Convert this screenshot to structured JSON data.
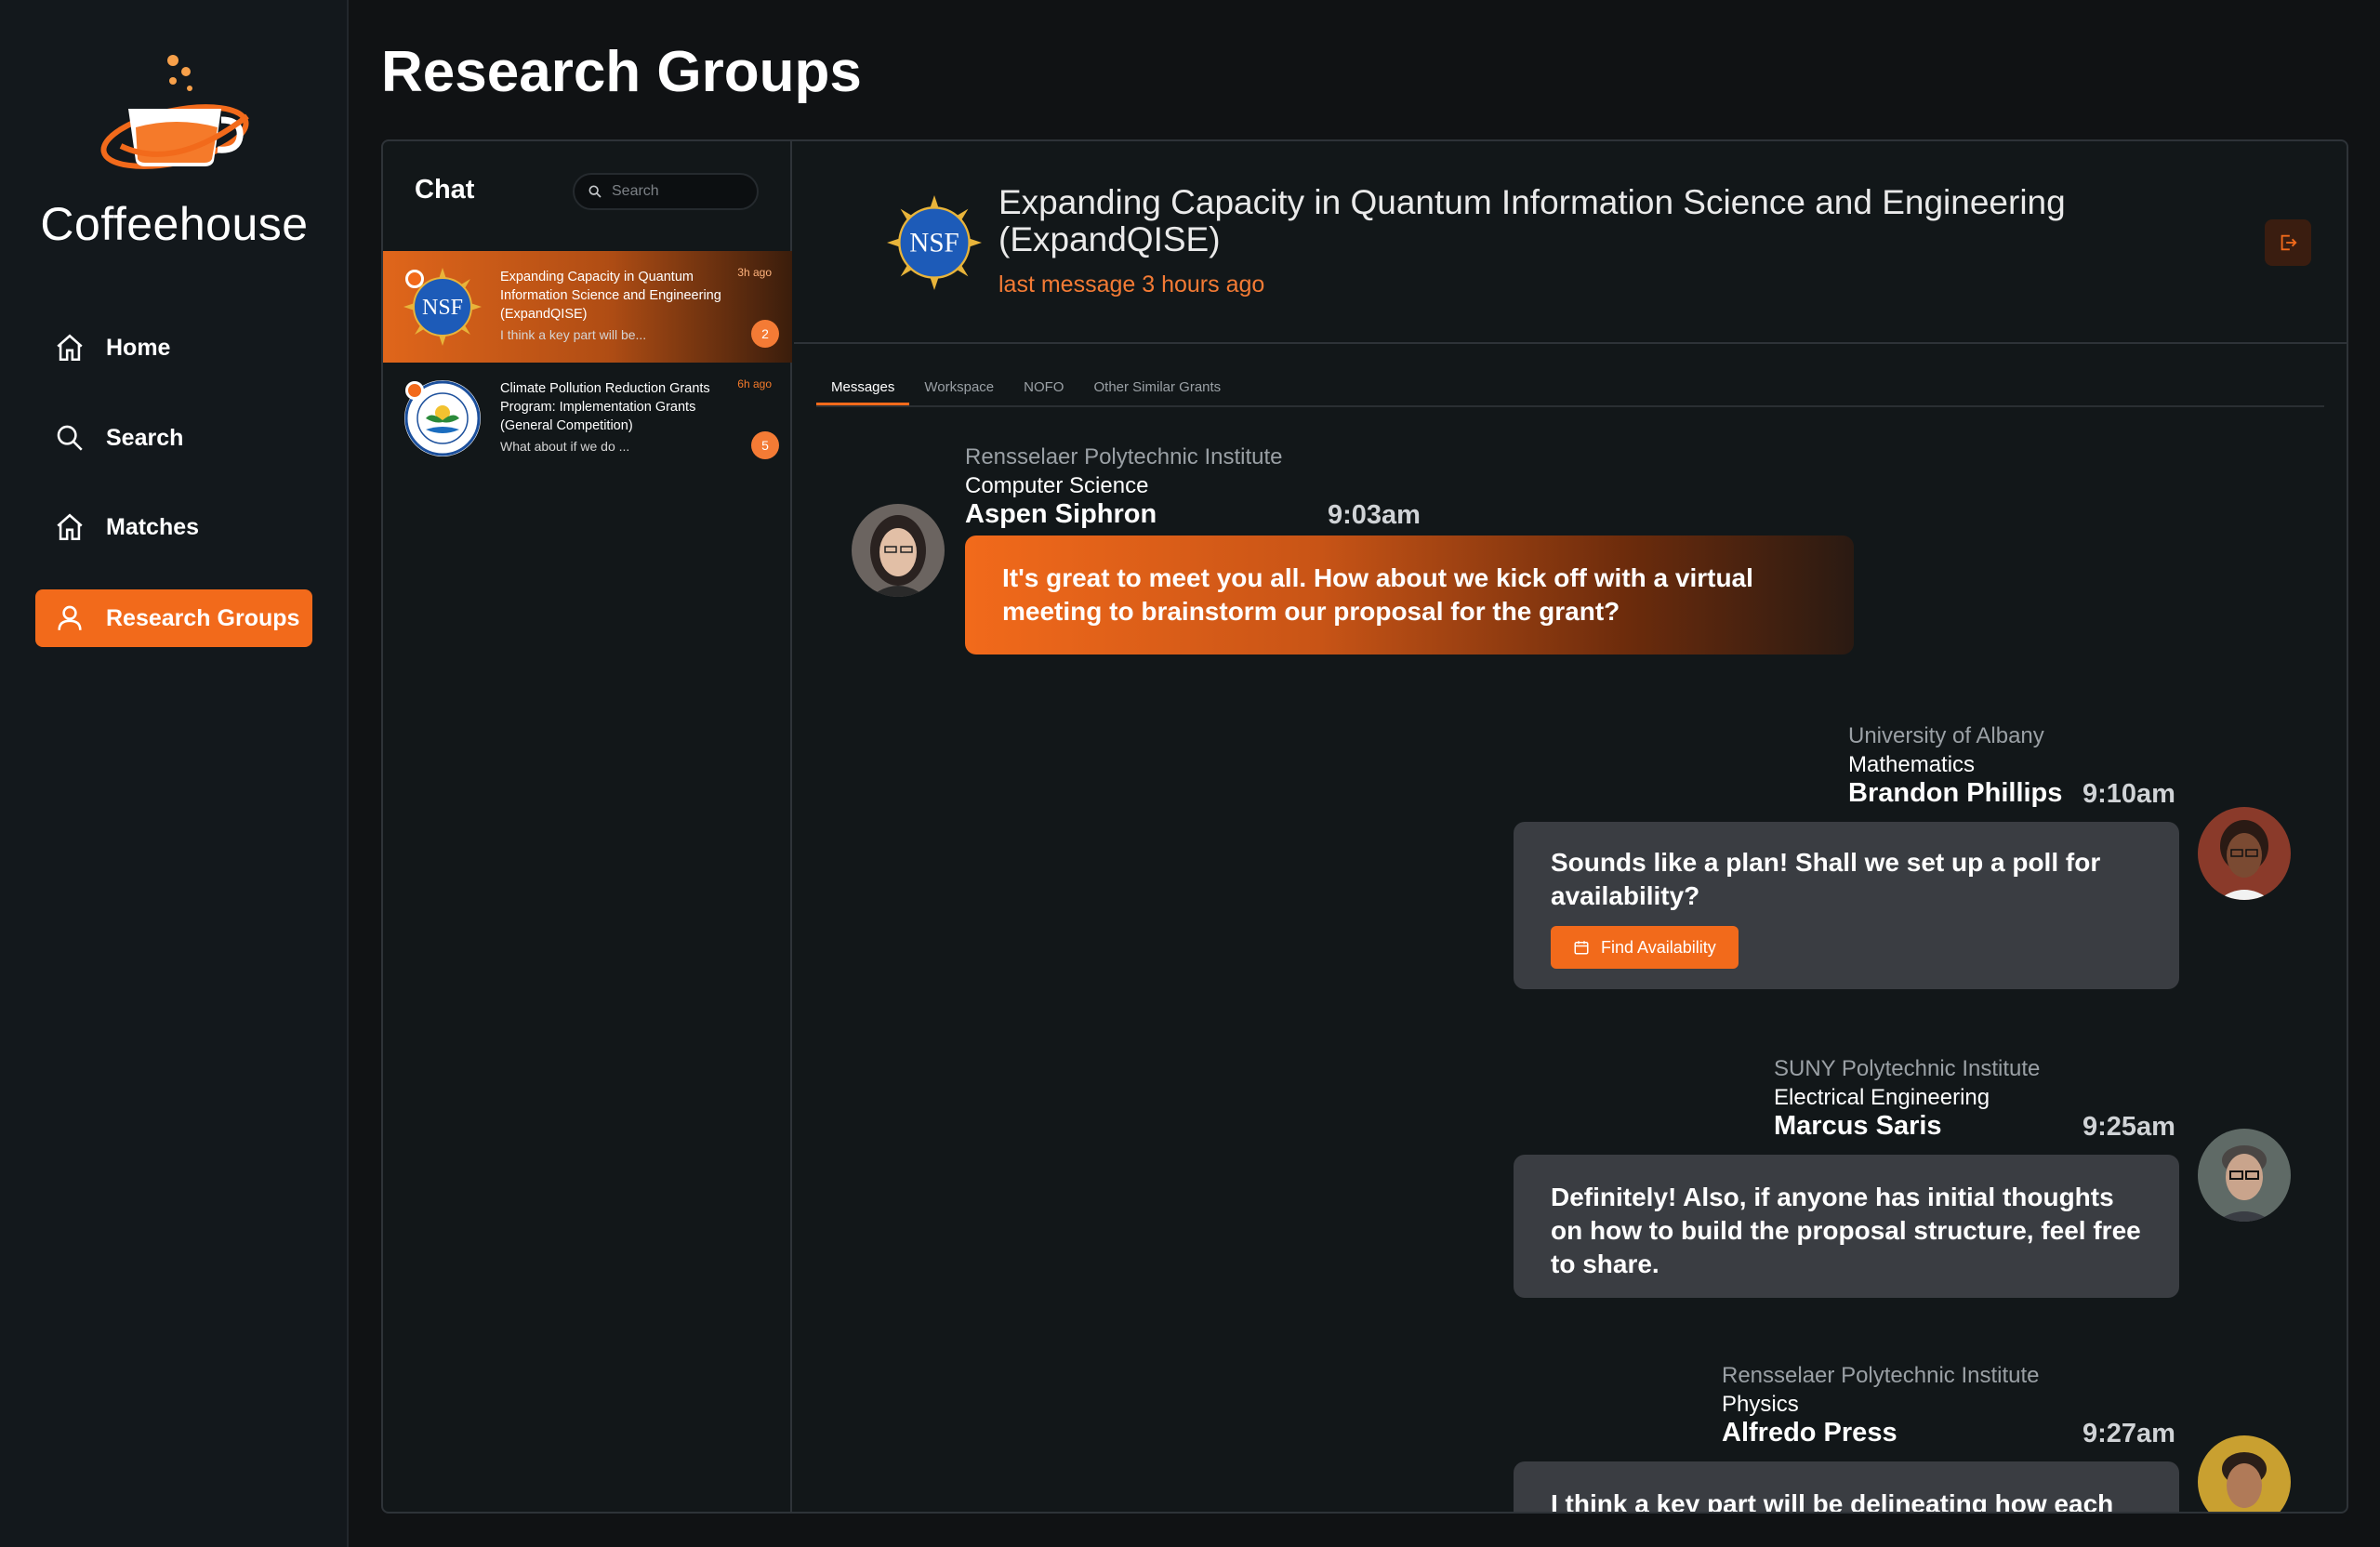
{
  "app": {
    "name": "Coffeehouse"
  },
  "sidebar": {
    "items": [
      {
        "label": "Home",
        "icon": "home-icon"
      },
      {
        "label": "Search",
        "icon": "search-icon"
      },
      {
        "label": "Matches",
        "icon": "home-icon"
      },
      {
        "label": "Research Groups",
        "icon": "user-icon",
        "active": true
      }
    ]
  },
  "page": {
    "title": "Research Groups"
  },
  "chat_list": {
    "title": "Chat",
    "search_placeholder": "Search",
    "conversations": [
      {
        "name": "Expanding Capacity in Quantum Information Science and Engineering (ExpandQISE)",
        "time": "3h ago",
        "snippet": "I think a key part will be...",
        "unread": "2",
        "avatar": "nsf-logo",
        "active": true
      },
      {
        "name": "Climate Pollution Reduction Grants Program: Implementation Grants (General Competition)",
        "time": "6h ago",
        "snippet": "What about if we do ...",
        "unread": "5",
        "avatar": "epa-logo",
        "active": false
      }
    ]
  },
  "conversation": {
    "title": "Expanding Capacity in Quantum Information Science and Engineering (ExpandQISE)",
    "subtitle": "last message 3 hours ago",
    "tabs": [
      "Messages",
      "Workspace",
      "NOFO",
      "Other Similar Grants"
    ],
    "active_tab": "Messages",
    "messages": [
      {
        "institution": "Rensselaer Polytechnic Institute",
        "department": "Computer Science",
        "name": "Aspen Siphron",
        "time": "9:03am",
        "text": "It's great to meet you all. How about we kick off with a virtual meeting to brainstorm our proposal for the grant?",
        "own": true
      },
      {
        "institution": "University of Albany",
        "department": "Mathematics",
        "name": "Brandon Phillips",
        "time": "9:10am",
        "text": "Sounds like a plan! Shall we set up a poll for availability?",
        "action_label": "Find Availability",
        "own": false
      },
      {
        "institution": "SUNY Polytechnic Institute",
        "department": "Electrical Engineering",
        "name": "Marcus Saris",
        "time": "9:25am",
        "text": "Definitely! Also, if anyone has initial thoughts on how to build the proposal structure, feel free to share.",
        "own": false
      },
      {
        "institution": "Rensselaer Polytechnic Institute",
        "department": "Physics",
        "name": "Alfredo Press",
        "time": "9:27am",
        "text": "I think a key part will be delineating how each",
        "own": false
      }
    ]
  },
  "colors": {
    "accent": "#f26a1b",
    "background": "#101214",
    "bubble_other": "#3a3d42"
  }
}
